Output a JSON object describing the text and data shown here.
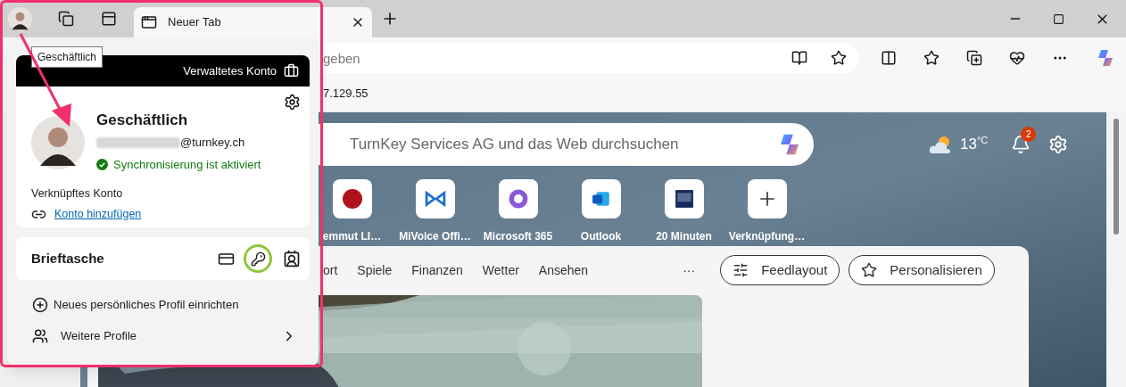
{
  "browser": {
    "tabs": [
      {
        "label": "Neuer Tab",
        "selected": true
      }
    ],
    "address_bar": {
      "placeholder": "geben"
    },
    "favorites_bar": {
      "items": [
        "7.129.55"
      ]
    }
  },
  "new_tab_page": {
    "search": {
      "placeholder": "TurnKey Services AG und das Web durchsuchen"
    },
    "weather": {
      "temperature": "13",
      "unit": "°C"
    },
    "notifications": {
      "count": "2"
    },
    "quick_links": [
      {
        "kind": "red-dot",
        "label": "emmut LI…"
      },
      {
        "kind": "bowtie",
        "label": "MiVoice Offi…"
      },
      {
        "kind": "ring",
        "label": "Microsoft 365"
      },
      {
        "kind": "mail",
        "label": "Outlook"
      },
      {
        "kind": "news",
        "label": "20 Minuten"
      },
      {
        "kind": "add",
        "label": "Verknüpfung…"
      }
    ],
    "feed": {
      "nav": [
        "ort",
        "Spiele",
        "Finanzen",
        "Wetter",
        "Ansehen"
      ],
      "more": "···",
      "buttons": [
        {
          "kind": "layout",
          "label": "Feedlayout"
        },
        {
          "kind": "personalize",
          "label": "Personalisieren"
        }
      ]
    }
  },
  "profile_flyout": {
    "tooltip": "Geschäftlich",
    "header": "Verwaltetes Konto",
    "name": "Geschäftlich",
    "email": "@turnkey.ch",
    "sync_status": "Synchronisierung ist aktiviert",
    "linked_account": {
      "label": "Verknüpftes Konto",
      "link": "Konto hinzufügen"
    },
    "wallet": {
      "label": "Brieftasche"
    },
    "actions": [
      {
        "kind": "add",
        "label": "Neues persönliches Profil einrichten"
      },
      {
        "kind": "submenu",
        "label": "Weitere Profile"
      }
    ]
  }
}
